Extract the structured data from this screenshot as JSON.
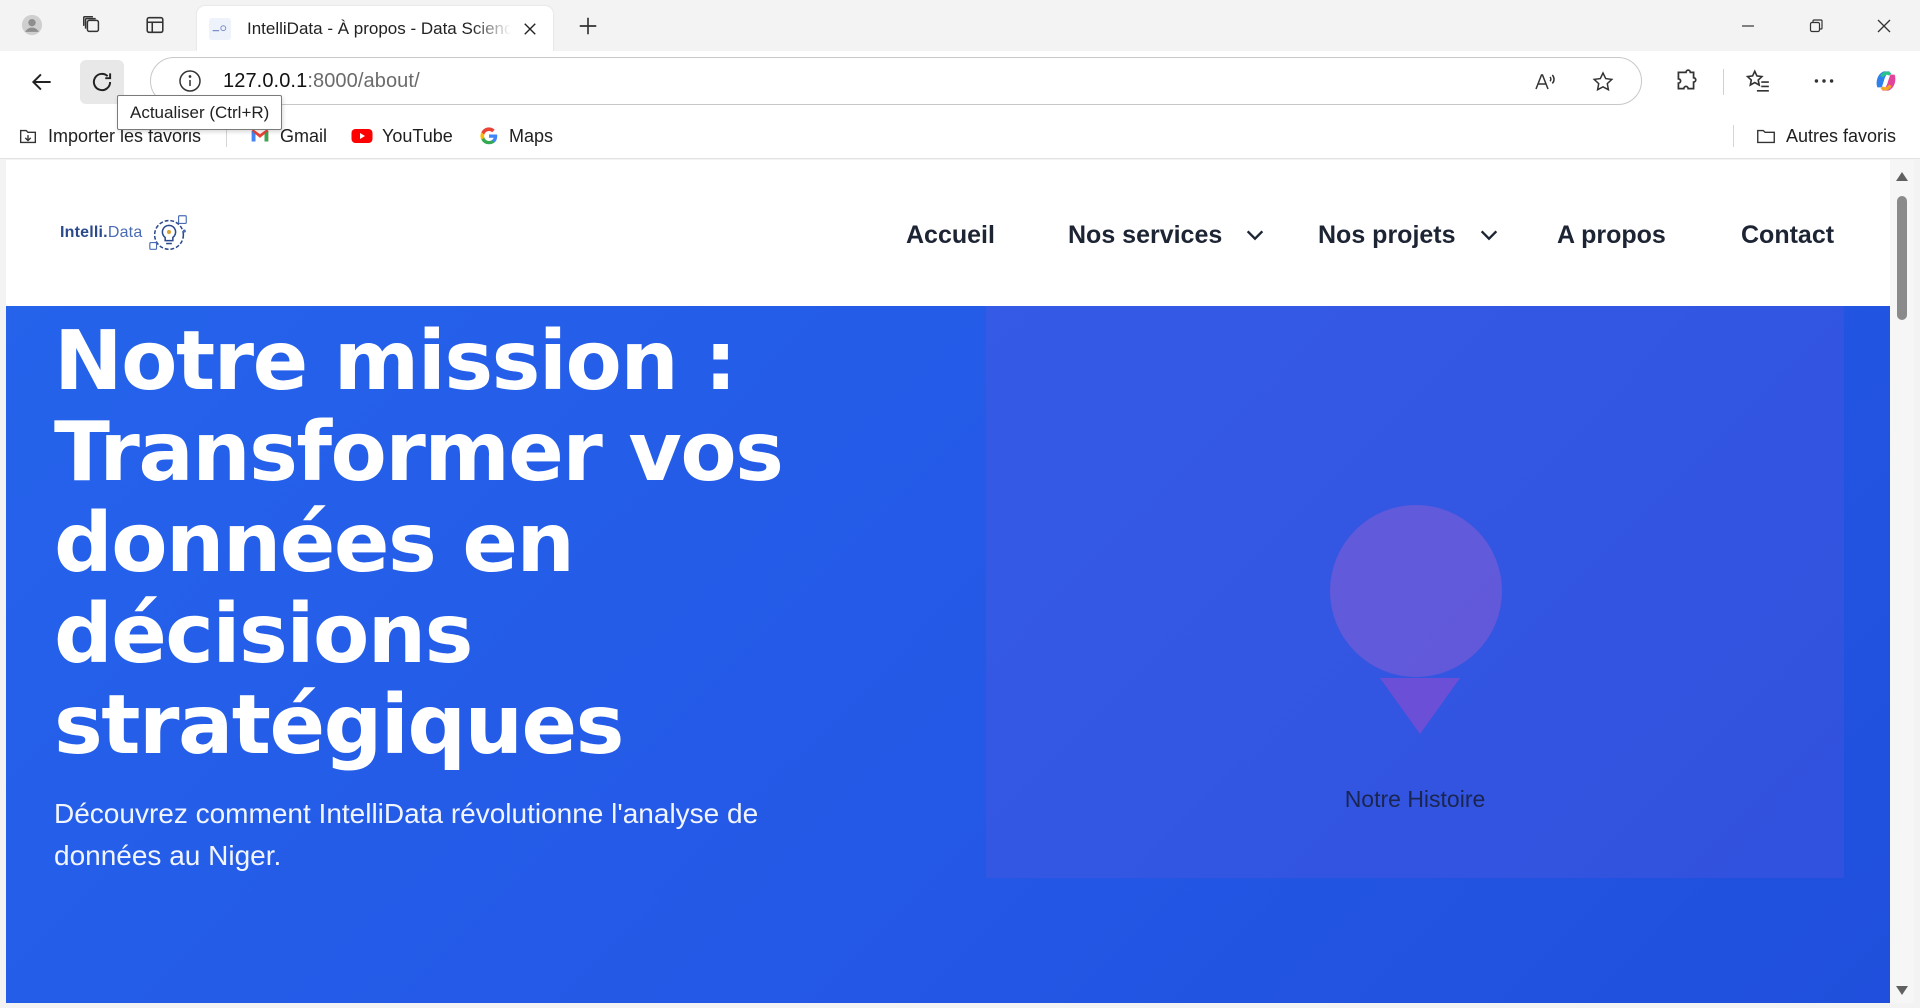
{
  "browser": {
    "tab_title": "IntelliData - À propos - Data Science",
    "url_host": "127.0.0.1",
    "url_path": ":8000/about/",
    "tooltip": "Actualiser (Ctrl+R)",
    "bookmarks": [
      {
        "label": "Importer les favoris",
        "icon": "import-favorites-icon"
      },
      {
        "label": "Gmail",
        "icon": "gmail-icon"
      },
      {
        "label": "YouTube",
        "icon": "youtube-icon"
      },
      {
        "label": "Maps",
        "icon": "google-icon"
      }
    ],
    "other_favorites": "Autres favoris"
  },
  "site": {
    "logo_main": "Intelli.",
    "logo_sub": "Data",
    "nav": [
      {
        "label": "Accueil"
      },
      {
        "label": "Nos services",
        "dropdown": true
      },
      {
        "label": "Nos projets",
        "dropdown": true
      },
      {
        "label": "A propos"
      },
      {
        "label": "Contact"
      }
    ]
  },
  "hero": {
    "title": "Notre mission : Transformer vos données en décisions stratégiques",
    "subtitle": "Découvrez comment IntelliData révolutionne l'analyse de données au Niger.",
    "media_caption": "Notre Histoire"
  },
  "colors": {
    "hero_blue": "#2563eb",
    "accent_purple": "#6a5bd8",
    "logo_blue": "#2b4a8c"
  }
}
